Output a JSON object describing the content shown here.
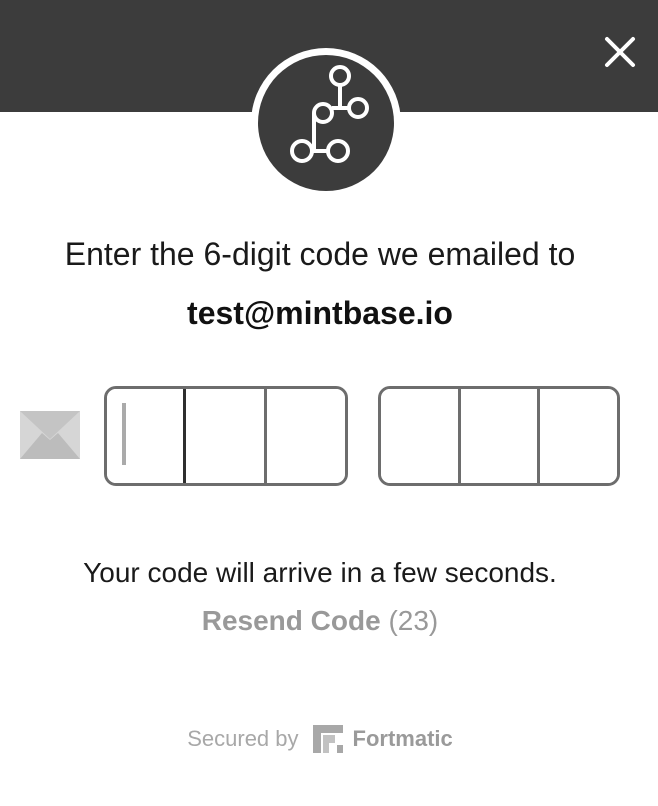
{
  "header": {
    "close_icon": "close-icon",
    "logo_icon": "workflow-nodes-icon"
  },
  "verify": {
    "headline": "Enter the 6-digit code we emailed to",
    "email": "test@mintbase.io",
    "mail_icon": "envelope-icon",
    "code_digits": [
      "",
      "",
      "",
      "",
      "",
      ""
    ]
  },
  "status": {
    "arrive_text": "Your code will arrive in a few seconds.",
    "resend_label": "Resend Code",
    "resend_countdown": "(23)"
  },
  "footer": {
    "secured_by": "Secured by",
    "brand_name": "Fortmatic",
    "brand_icon": "fortmatic-logo-icon"
  },
  "colors": {
    "header_bg": "#3c3c3c",
    "text_dark": "#1a1a1a",
    "text_muted": "#999999",
    "border": "#6d6d6d"
  }
}
